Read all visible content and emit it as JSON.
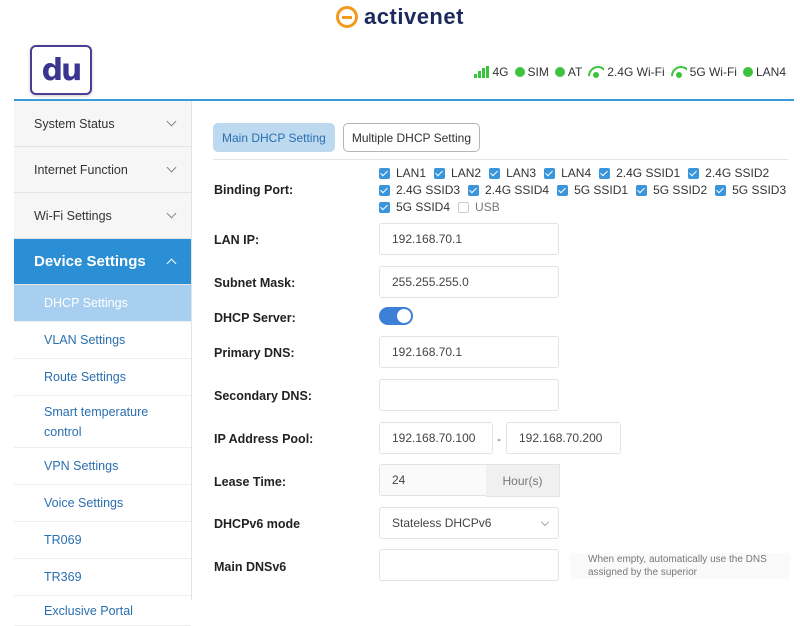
{
  "brand": {
    "name": "activenet"
  },
  "header": {
    "logo_text": "du",
    "status": [
      {
        "label": "4G",
        "icon": "signal-icon"
      },
      {
        "label": "SIM",
        "icon": "dot-icon"
      },
      {
        "label": "AT",
        "icon": "dot-icon"
      },
      {
        "label": "2.4G Wi-Fi",
        "icon": "wifi-icon"
      },
      {
        "label": "5G Wi-Fi",
        "icon": "wifi-icon"
      },
      {
        "label": "LAN4",
        "icon": "dot-icon"
      }
    ]
  },
  "sidebar": {
    "menus": [
      {
        "label": "System Status"
      },
      {
        "label": "Internet Function"
      },
      {
        "label": "Wi-Fi Settings"
      },
      {
        "label": "Device Settings"
      }
    ],
    "subs": [
      {
        "label": "DHCP Settings"
      },
      {
        "label": "VLAN Settings"
      },
      {
        "label": "Route Settings"
      },
      {
        "label": "Smart temperature control"
      },
      {
        "label": "VPN Settings"
      },
      {
        "label": "Voice Settings"
      },
      {
        "label": "TR069"
      },
      {
        "label": "TR369"
      },
      {
        "label": "Exclusive Portal"
      }
    ]
  },
  "tabs": [
    {
      "label": "Main DHCP Setting"
    },
    {
      "label": "Multiple DHCP Setting"
    }
  ],
  "form": {
    "binding_port_label": "Binding Port:",
    "ports_line1": [
      "LAN1",
      "LAN2",
      "LAN3",
      "LAN4",
      "2.4G SSID1",
      "2.4G SSID2"
    ],
    "ports_line2": [
      "2.4G SSID3",
      "2.4G SSID4",
      "5G SSID1",
      "5G SSID2",
      "5G SSID3"
    ],
    "ports_line3_checked": "5G SSID4",
    "ports_line3_unchecked": "USB",
    "lan_ip_label": "LAN IP:",
    "lan_ip": "192.168.70.1",
    "subnet_label": "Subnet Mask:",
    "subnet": "255.255.255.0",
    "dhcp_server_label": "DHCP Server:",
    "primary_dns_label": "Primary DNS:",
    "primary_dns": "192.168.70.1",
    "secondary_dns_label": "Secondary DNS:",
    "secondary_dns": "",
    "pool_label": "IP Address Pool:",
    "pool_start": "192.168.70.100",
    "pool_sep": "-",
    "pool_end": "192.168.70.200",
    "lease_label": "Lease Time:",
    "lease": "24",
    "lease_unit": "Hour(s)",
    "dhcpv6_label": "DHCPv6 mode",
    "dhcpv6_mode": "Stateless DHCPv6",
    "main_dnsv6_label": "Main DNSv6",
    "main_dnsv6": "",
    "dnsv6_hint": "When empty, automatically use the DNS assigned by the superior"
  }
}
